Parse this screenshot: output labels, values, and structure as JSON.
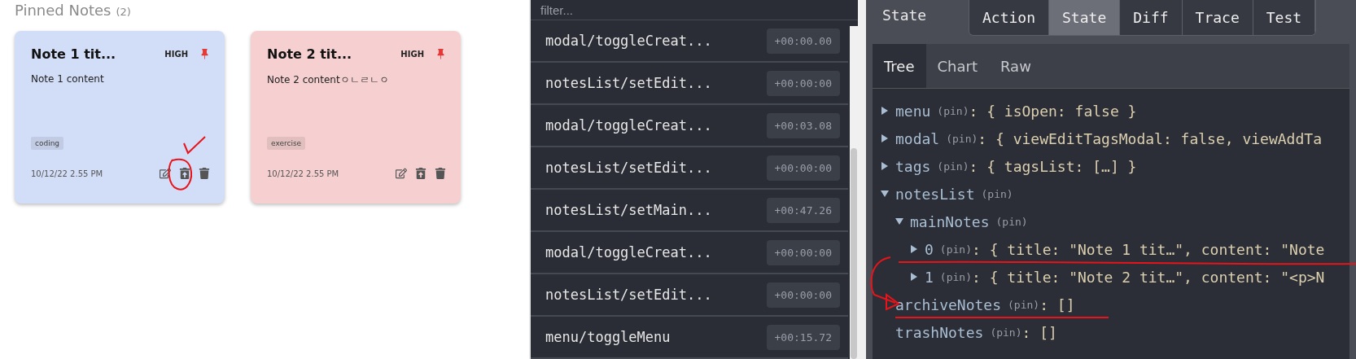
{
  "pinned": {
    "title": "Pinned Notes",
    "count": "(2)",
    "notes": [
      {
        "title": "Note 1 tit...",
        "priority": "HIGH",
        "pinned": true,
        "content": "Note 1 content",
        "tag": "coding",
        "date": "10/12/22 2.55 PM",
        "color": "#d2ddf7"
      },
      {
        "title": "Note 2 tit...",
        "priority": "HIGH",
        "pinned": true,
        "content": "Note 2 contentㅇㄴㄹㄴㅇ",
        "tag": "exercise",
        "date": "10/12/22 2.55 PM",
        "color": "#f6d0d0"
      }
    ]
  },
  "actions": {
    "filter_placeholder": "filter...",
    "items": [
      {
        "name": "modal/toggleCreat...",
        "time": "+00:00.00"
      },
      {
        "name": "notesList/setEdit...",
        "time": "+00:00:00"
      },
      {
        "name": "modal/toggleCreat...",
        "time": "+00:03.08"
      },
      {
        "name": "notesList/setEdit...",
        "time": "+00:00:00"
      },
      {
        "name": "notesList/setMain...",
        "time": "+00:47.26"
      },
      {
        "name": "modal/toggleCreat...",
        "time": "+00:00:00"
      },
      {
        "name": "notesList/setEdit...",
        "time": "+00:00:00"
      },
      {
        "name": "menu/toggleMenu",
        "time": "+00:15.72"
      }
    ]
  },
  "inspector": {
    "label": "State",
    "tabs": [
      {
        "label": "Action",
        "selected": false
      },
      {
        "label": "State",
        "selected": true
      },
      {
        "label": "Diff",
        "selected": false
      },
      {
        "label": "Trace",
        "selected": false
      },
      {
        "label": "Test",
        "selected": false
      }
    ],
    "subtabs": [
      {
        "label": "Tree",
        "selected": true
      },
      {
        "label": "Chart",
        "selected": false
      },
      {
        "label": "Raw",
        "selected": false
      }
    ],
    "tree": [
      {
        "key": "menu",
        "pin": "(pin)",
        "value": ": { isOpen: false }",
        "expanded": false
      },
      {
        "key": "modal",
        "pin": "(pin)",
        "value": ": { viewEditTagsModal: false, viewAddTa",
        "expanded": false
      },
      {
        "key": "tags",
        "pin": "(pin)",
        "value": ": { tagsList: […] }",
        "expanded": false
      },
      {
        "key": "notesList",
        "pin": "(pin)",
        "expanded": true,
        "children": [
          {
            "key": "mainNotes",
            "pin": "(pin)",
            "expanded": true,
            "children": [
              {
                "key": "0",
                "pin": "(pin)",
                "value": ": { title: \"Note 1 tit…\", content: \"Note",
                "expanded": false
              },
              {
                "key": "1",
                "pin": "(pin)",
                "value": ": { title: \"Note 2 tit…\", content: \"<p>N",
                "expanded": false
              }
            ]
          },
          {
            "key": "archiveNotes",
            "pin": "(pin)",
            "value": ": []"
          },
          {
            "key": "trashNotes",
            "pin": "(pin)",
            "value": ": []"
          }
        ]
      }
    ]
  }
}
